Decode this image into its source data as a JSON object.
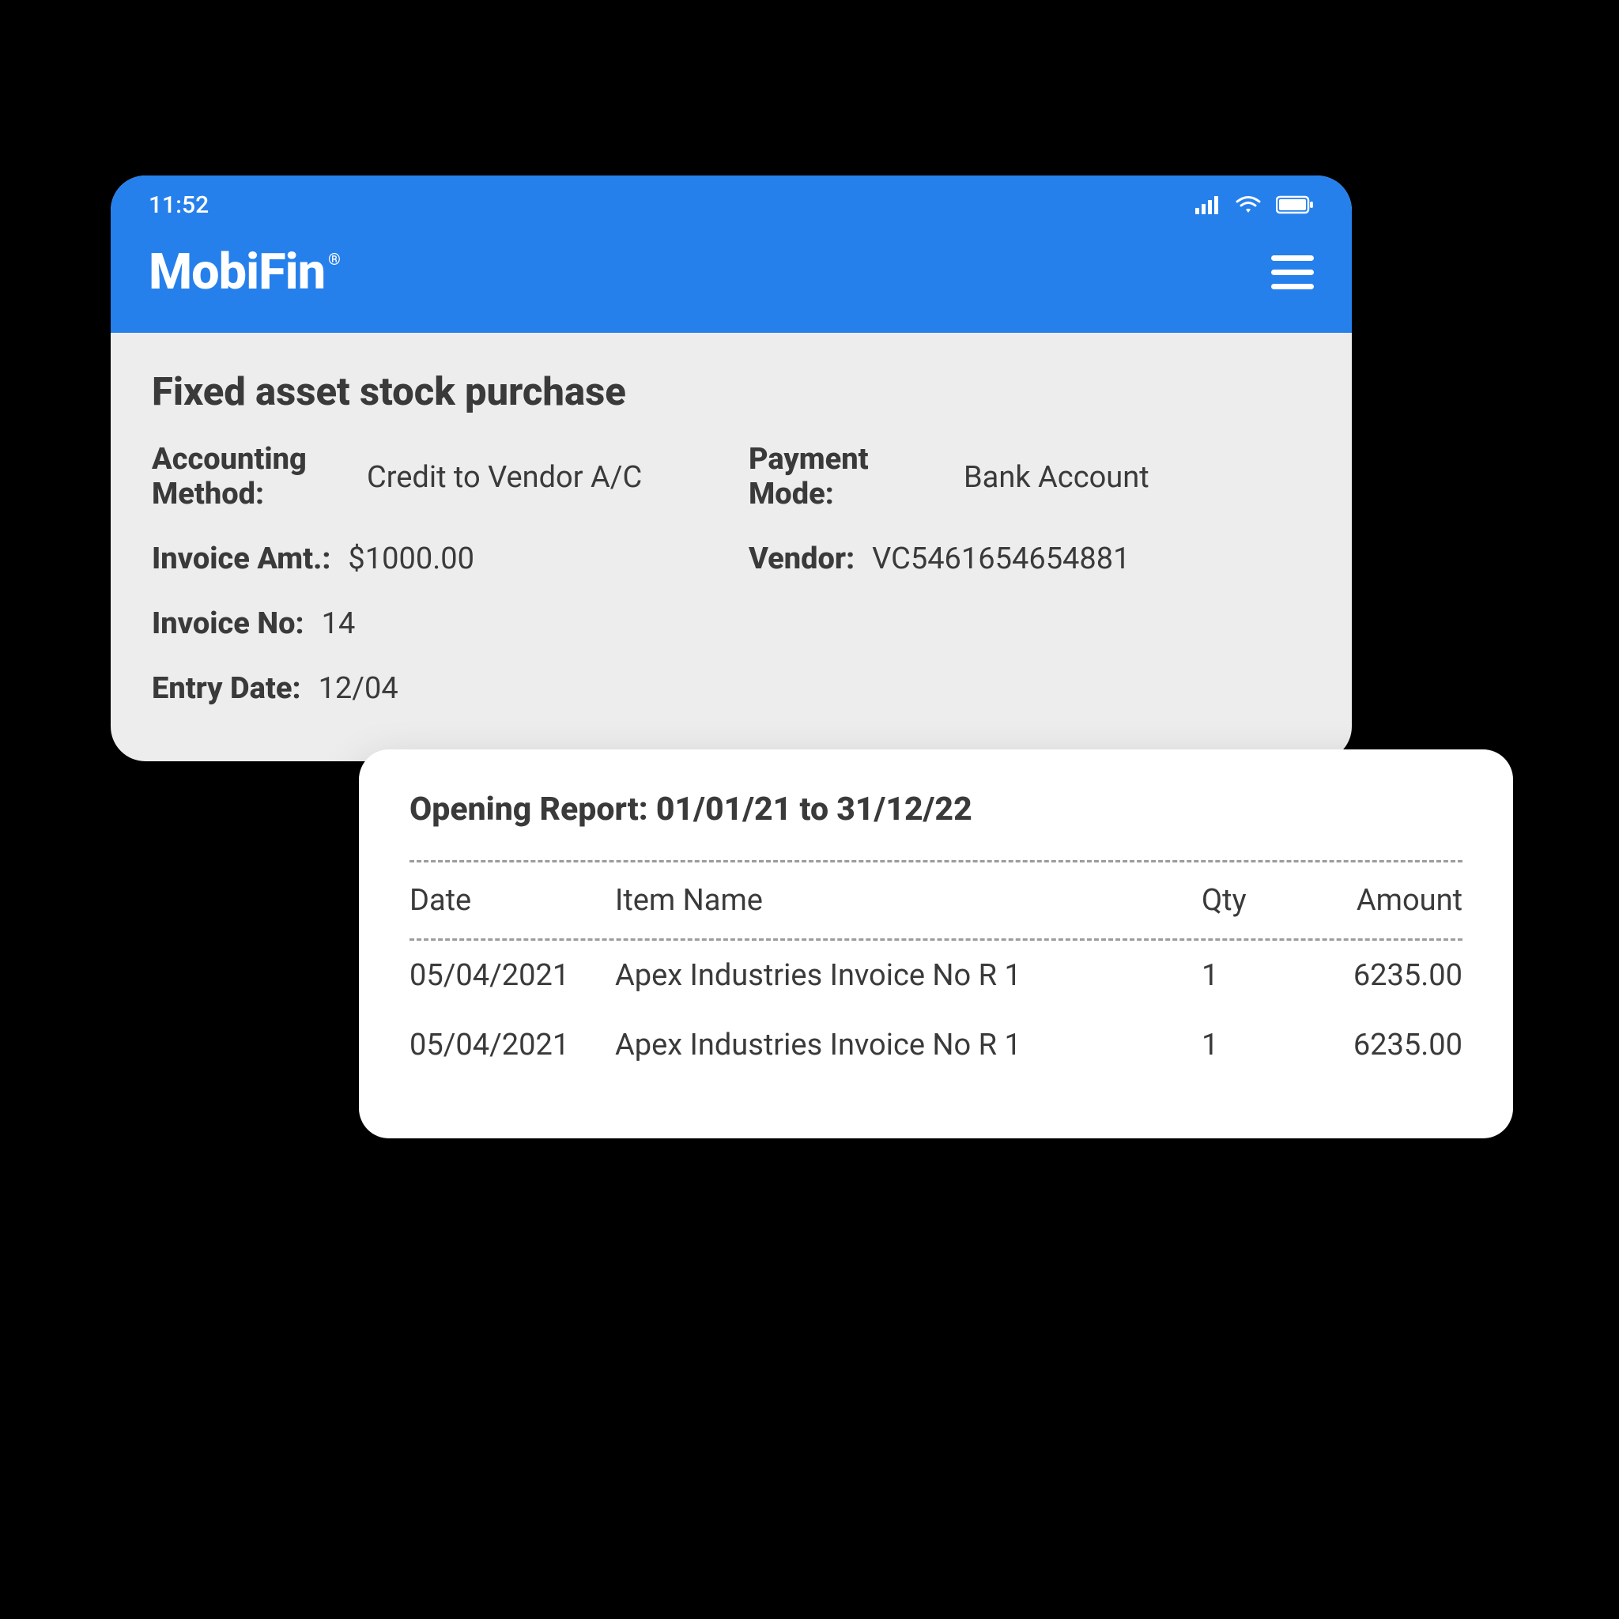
{
  "status_bar": {
    "time": "11:52"
  },
  "header": {
    "brand": "MobiFin",
    "brand_reg": "®"
  },
  "page": {
    "title": "Fixed asset stock purchase",
    "details": {
      "accounting_method_label": "Accounting Method:",
      "accounting_method_value": "Credit to Vendor A/C",
      "payment_mode_label": "Payment Mode:",
      "payment_mode_value": "Bank Account",
      "invoice_amt_label": "Invoice Amt.:",
      "invoice_amt_value": "$1000.00",
      "vendor_label": "Vendor:",
      "vendor_value": "VC5461654654881",
      "invoice_no_label": "Invoice No:",
      "invoice_no_value": "14",
      "entry_date_label": "Entry Date:",
      "entry_date_value": "12/04"
    }
  },
  "report": {
    "title": "Opening Report: 01/01/21 to 31/12/22",
    "columns": {
      "date": "Date",
      "item": "Item Name",
      "qty": "Qty",
      "amount": "Amount"
    },
    "rows": [
      {
        "date": "05/04/2021",
        "item": "Apex Industries Invoice No R 1",
        "qty": "1",
        "amount": "6235.00"
      },
      {
        "date": "05/04/2021",
        "item": "Apex Industries Invoice No R 1",
        "qty": "1",
        "amount": "6235.00"
      }
    ]
  },
  "colors": {
    "primary": "#2680EB"
  }
}
